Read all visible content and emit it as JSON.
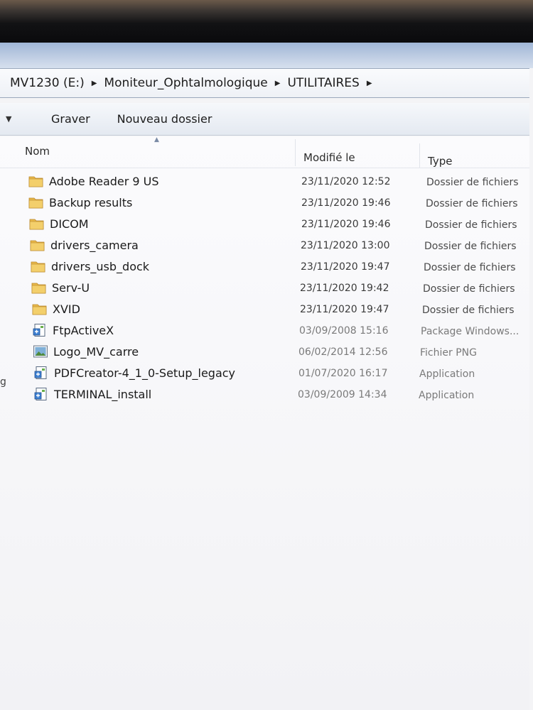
{
  "breadcrumb": [
    "MV1230 (E:)",
    "Moniteur_Ophtalmologique",
    "UTILITAIRES"
  ],
  "toolbar": {
    "burn_label": "Graver",
    "new_folder_label": "Nouveau dossier"
  },
  "columns": {
    "name": "Nom",
    "modified": "Modifié le",
    "type": "Type"
  },
  "left_edge_fragment": "g",
  "files": [
    {
      "name": "Adobe Reader 9 US",
      "modified": "23/11/2020 12:52",
      "type": "Dossier de fichiers",
      "icon": "folder-icon"
    },
    {
      "name": "Backup results",
      "modified": "23/11/2020 19:46",
      "type": "Dossier de fichiers",
      "icon": "folder-icon"
    },
    {
      "name": "DICOM",
      "modified": "23/11/2020 19:46",
      "type": "Dossier de fichiers",
      "icon": "folder-icon"
    },
    {
      "name": "drivers_camera",
      "modified": "23/11/2020 13:00",
      "type": "Dossier de fichiers",
      "icon": "folder-icon"
    },
    {
      "name": "drivers_usb_dock",
      "modified": "23/11/2020 19:47",
      "type": "Dossier de fichiers",
      "icon": "folder-icon"
    },
    {
      "name": "Serv-U",
      "modified": "23/11/2020 19:42",
      "type": "Dossier de fichiers",
      "icon": "folder-icon"
    },
    {
      "name": "XVID",
      "modified": "23/11/2020 19:47",
      "type": "Dossier de fichiers",
      "icon": "folder-icon"
    },
    {
      "name": "FtpActiveX",
      "modified": "03/09/2008 15:16",
      "type": "Package Windows...",
      "icon": "installer-icon"
    },
    {
      "name": "Logo_MV_carre",
      "modified": "06/02/2014 12:56",
      "type": "Fichier PNG",
      "icon": "image-file-icon"
    },
    {
      "name": "PDFCreator-4_1_0-Setup_legacy",
      "modified": "01/07/2020 16:17",
      "type": "Application",
      "icon": "installer-icon"
    },
    {
      "name": "TERMINAL_install",
      "modified": "03/09/2009 14:34",
      "type": "Application",
      "icon": "installer-icon"
    }
  ],
  "colors": {
    "folder": "#e8b84a",
    "title_band": "#bccbe2",
    "background": "#f4f4f6"
  }
}
